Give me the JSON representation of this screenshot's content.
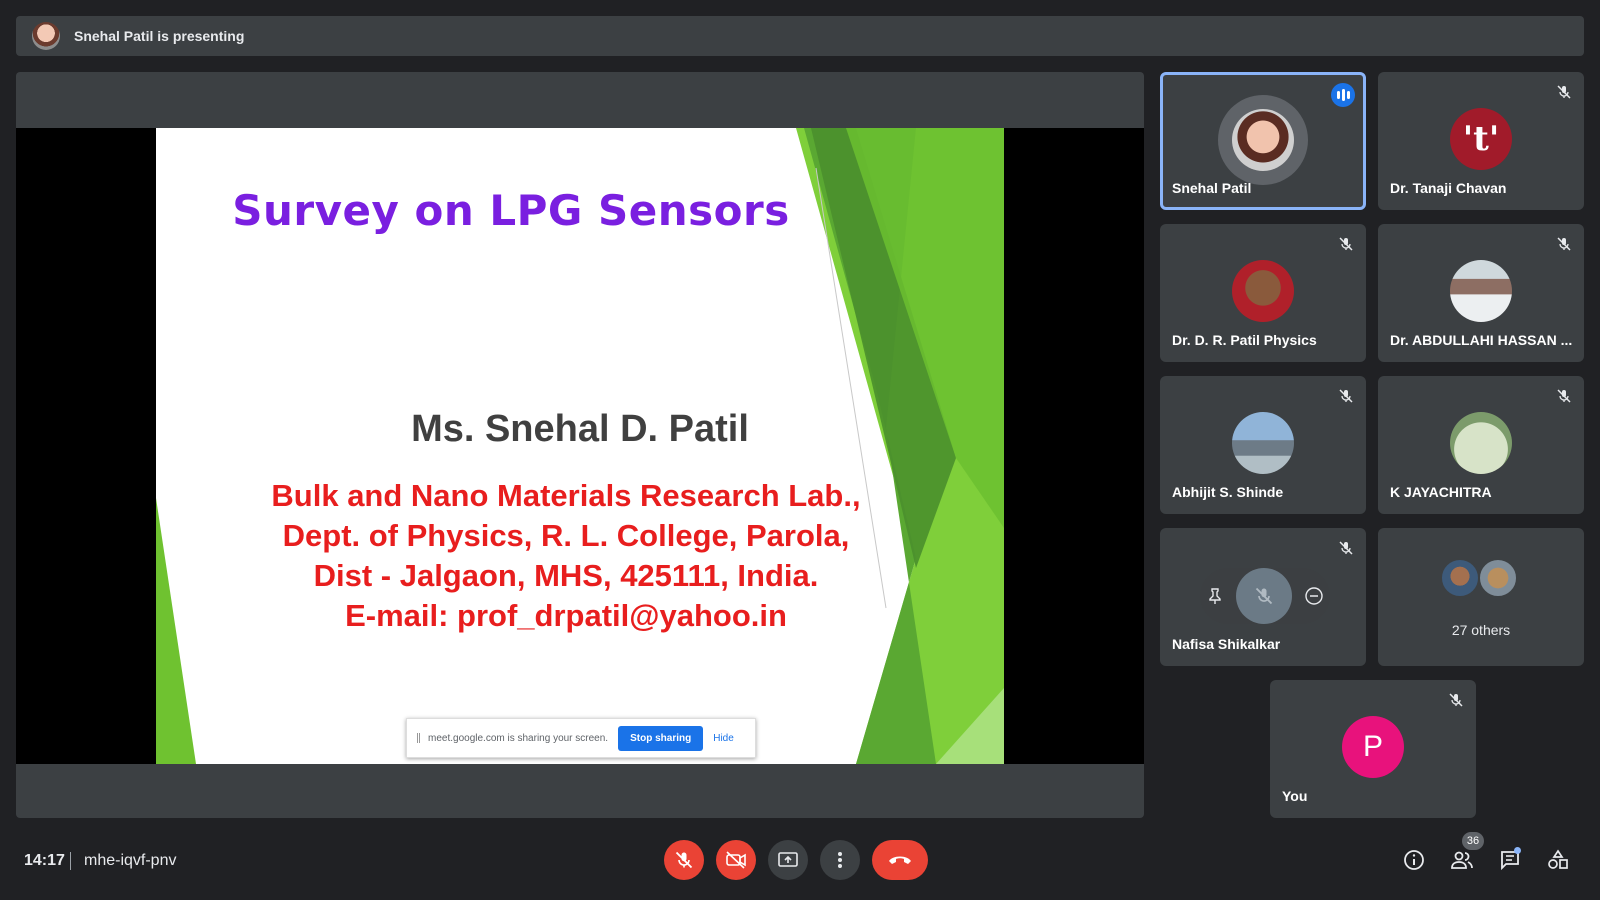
{
  "banner": {
    "presenting_text": "Snehal Patil is presenting"
  },
  "slide": {
    "title": "Survey on LPG Sensors",
    "author": "Ms. Snehal D. Patil",
    "affiliation_lines": [
      "Bulk and Nano Materials Research Lab.,",
      "Dept. of Physics, R. L. College, Parola,",
      "Dist - Jalgaon, MHS, 425111, India.",
      "E-mail: prof_drpatil@yahoo.in"
    ]
  },
  "share_bar": {
    "message": "meet.google.com is sharing your screen.",
    "stop_label": "Stop sharing",
    "hide_label": "Hide"
  },
  "participants": [
    {
      "name": "Snehal Patil",
      "speaking": true
    },
    {
      "name": "Dr. Tanaji Chavan",
      "initial": "'t'",
      "muted": true
    },
    {
      "name": "Dr. D. R. Patil Physics",
      "muted": true
    },
    {
      "name": "Dr. ABDULLAHI HASSAN ...",
      "muted": true
    },
    {
      "name": "Abhijit S. Shinde",
      "muted": true
    },
    {
      "name": "K JAYACHITRA",
      "muted": true
    },
    {
      "name": "Nafisa Shikalkar",
      "muted": true
    },
    {
      "others_label": "27 others"
    },
    {
      "name": "You",
      "initial": "P",
      "muted": true
    }
  ],
  "bottom_bar": {
    "time": "14:17",
    "meeting_code": "mhe-iqvf-pnv",
    "people_count": "36"
  },
  "colors": {
    "background": "#202124",
    "tile": "#3c4043",
    "danger": "#ea4335",
    "accent": "#8ab4f8",
    "you_avatar": "#e8127c",
    "tanaji_avatar": "#a11b2a"
  }
}
